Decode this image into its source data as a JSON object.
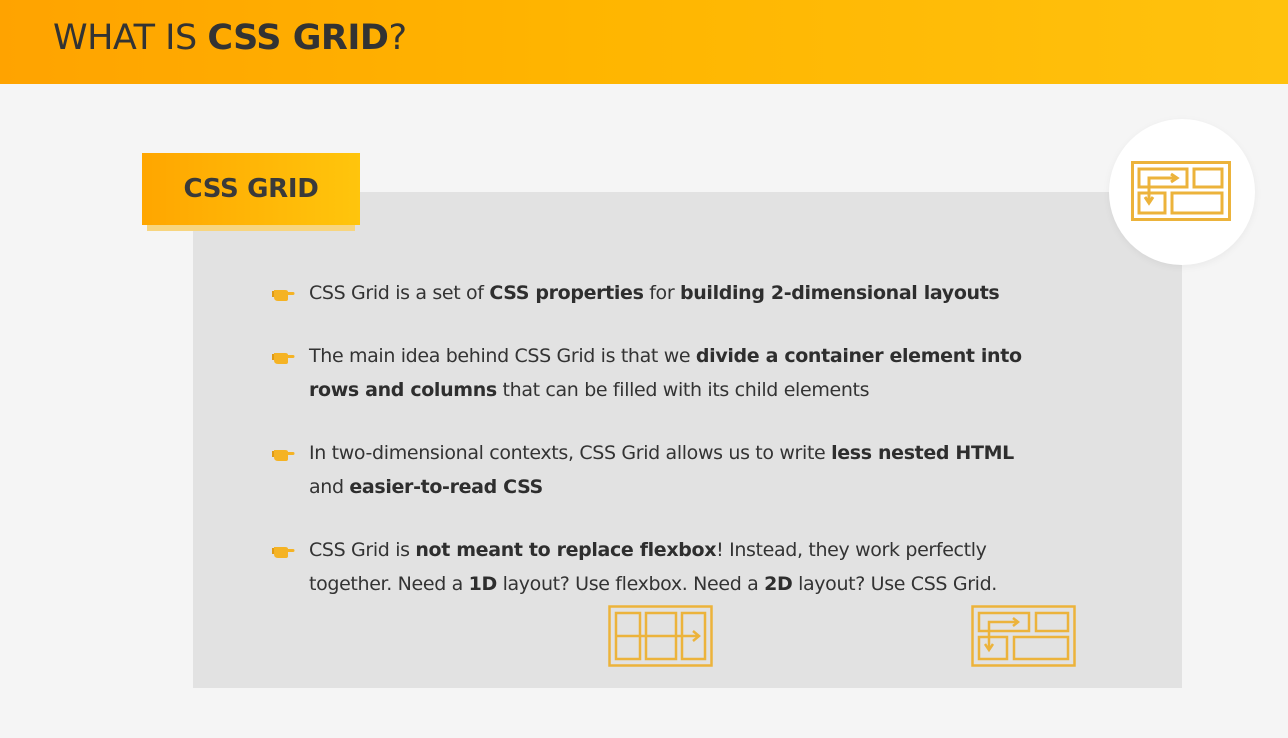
{
  "header": {
    "title_prefix": "WHAT IS ",
    "title_bold": "CSS GRID",
    "title_suffix": "?"
  },
  "badge": {
    "label": "CSS GRID"
  },
  "bullets": [
    {
      "icon": "pointing-hand-icon",
      "lines": [
        [
          {
            "t": "CSS Grid is a set of ",
            "b": false
          },
          {
            "t": "CSS properties",
            "b": true
          },
          {
            "t": " for ",
            "b": false
          },
          {
            "t": "building 2-dimensional layouts",
            "b": true
          }
        ]
      ]
    },
    {
      "icon": "pointing-hand-icon",
      "lines": [
        [
          {
            "t": "The main idea behind CSS Grid is that we ",
            "b": false
          },
          {
            "t": "divide a container element into",
            "b": true
          }
        ],
        [
          {
            "t": "rows and columns",
            "b": true
          },
          {
            "t": " that can be filled with its child elements",
            "b": false
          }
        ]
      ]
    },
    {
      "icon": "pointing-hand-icon",
      "lines": [
        [
          {
            "t": "In two-dimensional contexts, CSS Grid allows us to write ",
            "b": false
          },
          {
            "t": "less nested HTML",
            "b": true
          }
        ],
        [
          {
            "t": "and ",
            "b": false
          },
          {
            "t": "easier-to-read CSS",
            "b": true
          }
        ]
      ]
    },
    {
      "icon": "pointing-hand-icon",
      "lines": [
        [
          {
            "t": "CSS Grid is ",
            "b": false
          },
          {
            "t": "not meant to replace flexbox",
            "b": true
          },
          {
            "t": "! Instead, they work perfectly",
            "b": false
          }
        ],
        [
          {
            "t": "together. Need a ",
            "b": false
          },
          {
            "t": "1D",
            "b": true
          },
          {
            "t": " layout? Use flexbox. Need a ",
            "b": false
          },
          {
            "t": "2D",
            "b": true
          },
          {
            "t": " layout? Use CSS Grid.",
            "b": false
          }
        ]
      ]
    }
  ],
  "icons": {
    "corner": "grid-layout-icon",
    "one_d": "flexbox-1d-layout-icon",
    "two_d": "grid-2d-layout-icon"
  },
  "colors": {
    "accent": "#ffb000",
    "icon_stroke": "#ecb33b",
    "panel": "#e2e2e2",
    "background": "#f5f5f5",
    "text": "#333333"
  }
}
